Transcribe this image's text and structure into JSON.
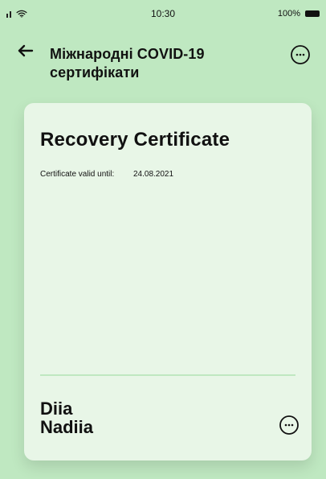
{
  "status_bar": {
    "time": "10:30",
    "battery": "100%"
  },
  "header": {
    "title": "Міжнародні COVID-19 сертифікати"
  },
  "card": {
    "title": "Recovery Certificate",
    "meta": {
      "label": "Certificate valid until:",
      "value": "24.08.2021"
    },
    "holder": {
      "line1": "Diia",
      "line2": "Nadiia"
    }
  },
  "icons": {
    "back": "back-arrow-icon",
    "more": "more-icon",
    "wifi": "wifi-icon",
    "signal": "signal-icon",
    "battery": "battery-icon"
  }
}
